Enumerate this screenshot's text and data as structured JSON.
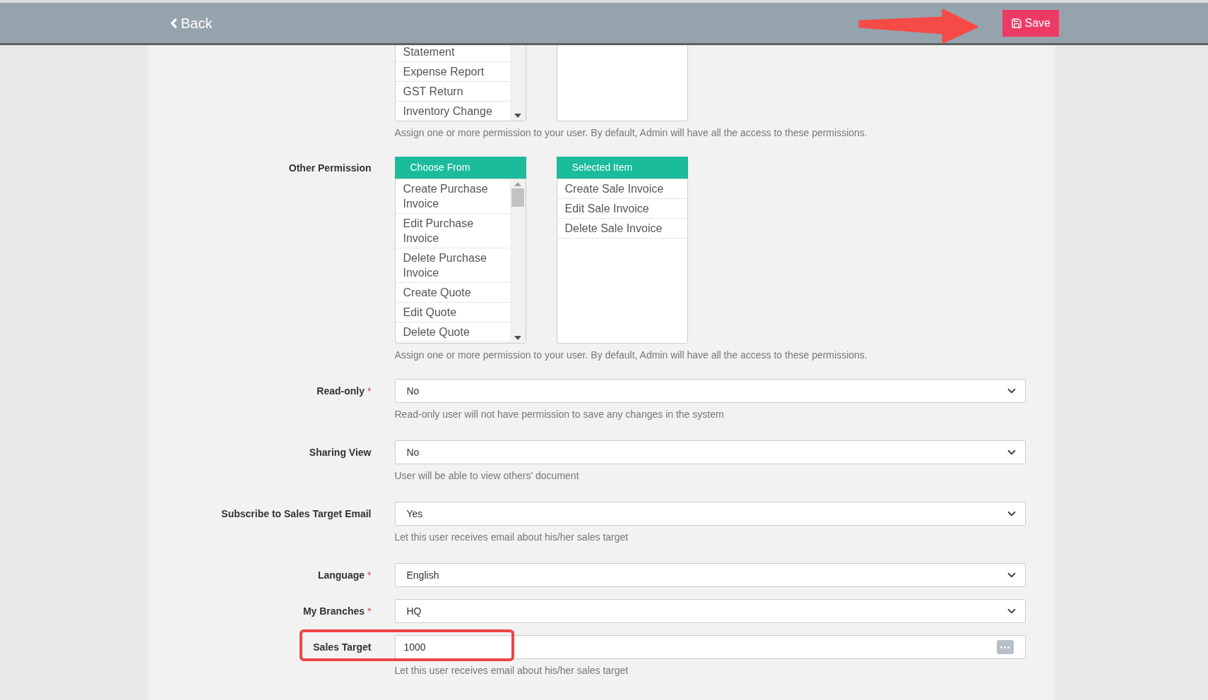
{
  "header": {
    "back_label": "Back",
    "save_label": "Save"
  },
  "report_permission": {
    "choose_items": [
      "Statement",
      "Expense Report",
      "GST Return",
      "Inventory Change"
    ],
    "help": "Assign one or more permission to your user. By default, Admin will have all the access to these permissions."
  },
  "other_permission": {
    "label": "Other Permission",
    "choose_header": "Choose From",
    "selected_header": "Selected Item",
    "choose_items": [
      "Create Purchase Invoice",
      "Edit Purchase Invoice",
      "Delete Purchase Invoice",
      "Create Quote",
      "Edit Quote",
      "Delete Quote"
    ],
    "selected_items": [
      "Create Sale Invoice",
      "Edit Sale Invoice",
      "Delete Sale Invoice"
    ],
    "help": "Assign one or more permission to your user. By default, Admin will have all the access to these permissions."
  },
  "fields": [
    {
      "kind": "select",
      "label": "Read-only",
      "required_mark": "*",
      "value": "No",
      "help": "Read-only user will not have permission to save any changes in the system",
      "highlighted": false
    },
    {
      "kind": "select",
      "label": "Sharing View",
      "value": "No",
      "help": "User will be able to view others' document",
      "highlighted": false
    },
    {
      "kind": "select",
      "label": "Subscribe to Sales Target Email",
      "value": "Yes",
      "help": "Let this user receives email about his/her sales target",
      "highlighted": false
    },
    {
      "kind": "select",
      "label": "Language",
      "required_mark": "*",
      "value": "English",
      "highlighted": false
    },
    {
      "kind": "select",
      "label": "My Branches",
      "required_mark": "*",
      "value": "HQ",
      "highlighted": false
    },
    {
      "kind": "text",
      "label": "Sales Target",
      "value": "1000",
      "help": "Let this user receives email about his/her sales target",
      "highlighted": true
    }
  ]
}
